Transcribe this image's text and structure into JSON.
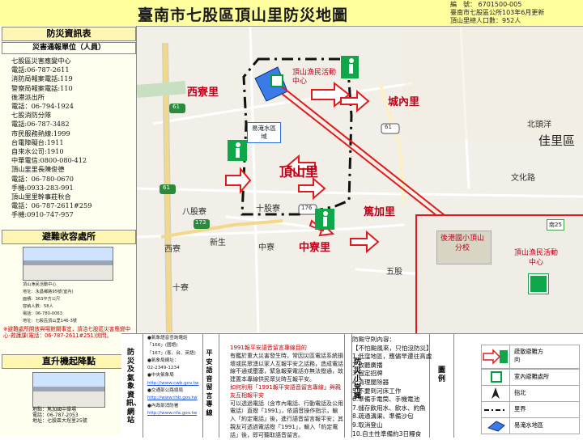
{
  "header": {
    "title": "臺南市七股區頂山里防災地圖",
    "meta": [
      "編　號： 6701500-005",
      "臺南市七股區公所103年6月更新",
      "頂山里總人口數：952人"
    ]
  },
  "left": {
    "disaster_head": "防災資訊表",
    "contact_head": "災害通報單位（人員）",
    "contacts": [
      "七股區災害應變中心",
      "電話:06-787-2611",
      "消防局報案電話:119",
      "警察局報案電話:110",
      "後港派出所",
      "電話：06-794-1924",
      "七股消防分隊",
      "電話:06-787-3482",
      "市民服務熱線:1999",
      "台電障礙台:1911",
      "自來水公司:1910",
      "中華電信:0800-080-412",
      "頂山里里長陳俊德",
      "電話：06-780-0670",
      "手機:0933-283-991",
      "頂山里里幹事莊秋合",
      "電話：06-787-2611#259",
      "手機:0910-747-957"
    ],
    "shelter_head": "避難收容處所",
    "shelter_info": [
      "頂山漁民活動中心",
      "地址：永昌鄉路95號(室內)",
      "面積：363平方公尺",
      "容納人數：58人",
      "電話：06-780-0063",
      "地址：七股區頂山里146-3號"
    ],
    "shelter_note": "※避難處所開放與場館關事宜，請洽七股區災害應變中心-救護課(電話：06-787-2611#251)詢問。",
    "heli_head": "直升機起降點",
    "heli_info": [
      "地點：篤加國中操場",
      "電話：06-787-2053",
      "地址：七股區大埕里25號"
    ]
  },
  "map": {
    "region_labels": [
      {
        "text": "西寮里",
        "color": "#c0001a"
      },
      {
        "text": "城內里",
        "color": "#c0001a"
      },
      {
        "text": "頂山里",
        "color": "#c0001a"
      },
      {
        "text": "篤加里",
        "color": "#c0001a"
      },
      {
        "text": "中寮里",
        "color": "#c0001a"
      }
    ],
    "place_labels": [
      "北頭洋",
      "佳里區",
      "文化路",
      "十股寮",
      "八股寮",
      "西寮",
      "新生",
      "中寮",
      "五股",
      "十寮"
    ],
    "road_numbers": [
      "61",
      "61",
      "173",
      "176",
      "61"
    ],
    "shelter_label": "頂山漁民活動中心",
    "flood_box_label": "易淹水區域",
    "inset": {
      "school_label": "後港國小頂山分校",
      "shelter_label": "頂山漁民活動中心",
      "road_label": "南25"
    }
  },
  "bottom": {
    "contact_title": "防災及氣象資訊、網站",
    "phone_lines": [
      "●氣象語音查詢電話",
      "「166」(國語)",
      "「167」(客、台、英語)",
      "●氣象局網址：",
      "02-2349-1234",
      "●中央氣象局",
      "http://www.cwb.gov.tw",
      "●交通部公路總局",
      "http://www.thb.gov.tw",
      "●內政部消防署",
      "http://www.nfa.gov.tw"
    ],
    "notice_tag": "平安語音留言專線",
    "notice_title": "1991報平安語音留言專線目的",
    "notice_body": "有鑑於重大災害發生時，常因災區電話系統損壞或民眾湧以家人互報平安之話務，造成電話線不通或壅塞，緊急報案電話亦無法撥通，故建置本專線供民眾災時互報平安。",
    "notice_red": "如何利用「1991報平安語音留言專線」與親友互相報平安",
    "notice_tail": "可以透過電話（含市內電話、行動電話及公用電話）直撥「1991」，依語音操作指示，輸入「約定電話」後，進行語音留言報平安；其親友可透過電話撥「1991」，輸入「約定電話」後，即可聽取語音留言。",
    "prep_title": "防災小常識",
    "prep_lines": [
      "防颱守則內容：",
      "【不怕颱風來，只怕沒防災】",
      "1.低窪地區，應儘早遷往高處",
      "2.收聽廣播",
      "3.固定招牌",
      "4.清理屋除器",
      "5.不要到河床工作",
      "6.準備手電筒、手機電池",
      "7.儲存飲用水、飲水、約魚",
      "8.疏通溝渠、準備沙包",
      "9.取消登山",
      "10.自主性準備約3日糧食"
    ],
    "legend_title": "圖例",
    "legend": [
      "疏散避難方向",
      "室內避難處所",
      "指北",
      "里界",
      "易淹水地區"
    ]
  },
  "colors": {
    "red": "#e21a1a",
    "title_bg": "#ffff9e",
    "shelter_green": "#00a040",
    "flood_blue": "#1e6fe0",
    "green_icon": "#10a64a"
  }
}
